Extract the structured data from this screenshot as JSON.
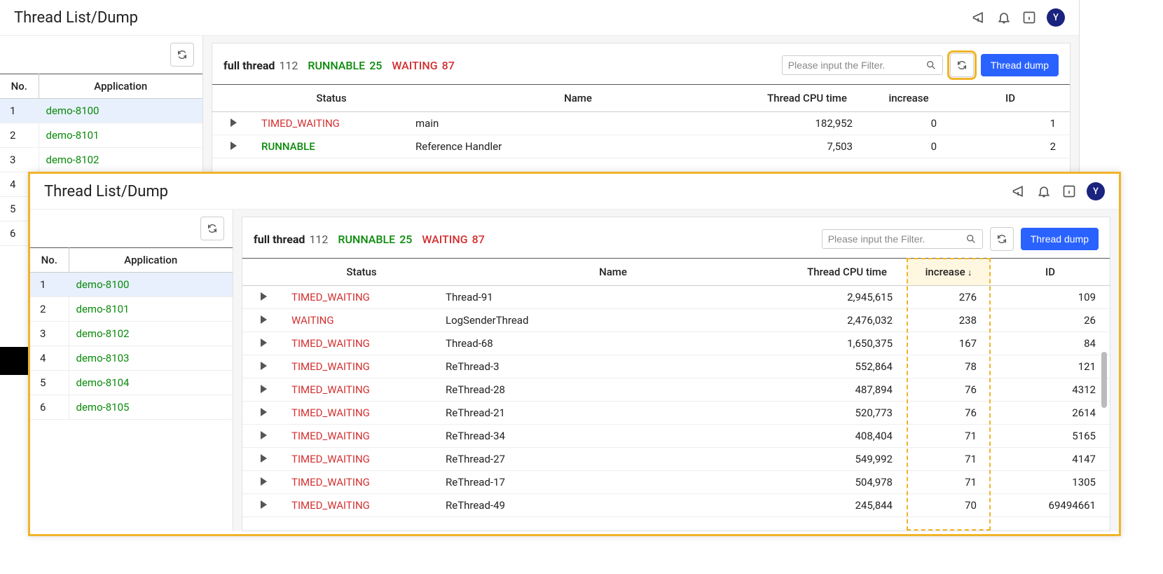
{
  "title": "Thread List/Dump",
  "avatar_letter": "Y",
  "search_placeholder": "Please input the Filter.",
  "thread_dump_btn": "Thread dump",
  "summary": {
    "full_label": "full thread",
    "full_count": "112",
    "runnable_label": "RUNNABLE",
    "runnable_count": "25",
    "waiting_label": "WAITING",
    "waiting_count": "87"
  },
  "sidebar_headers": {
    "no": "No.",
    "app": "Application"
  },
  "thread_headers": {
    "status": "Status",
    "name": "Name",
    "cpu": "Thread CPU time",
    "inc": "increase",
    "id": "ID"
  },
  "back": {
    "apps": [
      {
        "no": "1",
        "name": "demo-8100",
        "selected": true
      },
      {
        "no": "2",
        "name": "demo-8101"
      },
      {
        "no": "3",
        "name": "demo-8102"
      },
      {
        "no": "4",
        "name": ""
      },
      {
        "no": "5",
        "name": ""
      },
      {
        "no": "6",
        "name": ""
      }
    ],
    "rows": [
      {
        "status": "TIMED_WAITING",
        "status_cls": "",
        "name": "main",
        "cpu": "182,952",
        "inc": "0",
        "id": "1"
      },
      {
        "status": "RUNNABLE",
        "status_cls": "runnable",
        "name": "Reference Handler",
        "cpu": "7,503",
        "inc": "0",
        "id": "2"
      }
    ]
  },
  "front": {
    "apps": [
      {
        "no": "1",
        "name": "demo-8100",
        "selected": true
      },
      {
        "no": "2",
        "name": "demo-8101"
      },
      {
        "no": "3",
        "name": "demo-8102"
      },
      {
        "no": "4",
        "name": "demo-8103"
      },
      {
        "no": "5",
        "name": "demo-8104"
      },
      {
        "no": "6",
        "name": "demo-8105"
      }
    ],
    "rows": [
      {
        "status": "TIMED_WAITING",
        "name": "Thread-91",
        "cpu": "2,945,615",
        "inc": "276",
        "id": "109"
      },
      {
        "status": "WAITING",
        "name": "LogSenderThread",
        "cpu": "2,476,032",
        "inc": "238",
        "id": "26"
      },
      {
        "status": "TIMED_WAITING",
        "name": "Thread-68",
        "cpu": "1,650,375",
        "inc": "167",
        "id": "84"
      },
      {
        "status": "TIMED_WAITING",
        "name": "ReThread-3",
        "cpu": "552,864",
        "inc": "78",
        "id": "121"
      },
      {
        "status": "TIMED_WAITING",
        "name": "ReThread-28",
        "cpu": "487,894",
        "inc": "76",
        "id": "4312"
      },
      {
        "status": "TIMED_WAITING",
        "name": "ReThread-21",
        "cpu": "520,773",
        "inc": "76",
        "id": "2614"
      },
      {
        "status": "TIMED_WAITING",
        "name": "ReThread-34",
        "cpu": "408,404",
        "inc": "71",
        "id": "5165"
      },
      {
        "status": "TIMED_WAITING",
        "name": "ReThread-27",
        "cpu": "549,992",
        "inc": "71",
        "id": "4147"
      },
      {
        "status": "TIMED_WAITING",
        "name": "ReThread-17",
        "cpu": "504,978",
        "inc": "71",
        "id": "1305"
      },
      {
        "status": "TIMED_WAITING",
        "name": "ReThread-49",
        "cpu": "245,844",
        "inc": "70",
        "id": "69494661"
      }
    ]
  }
}
